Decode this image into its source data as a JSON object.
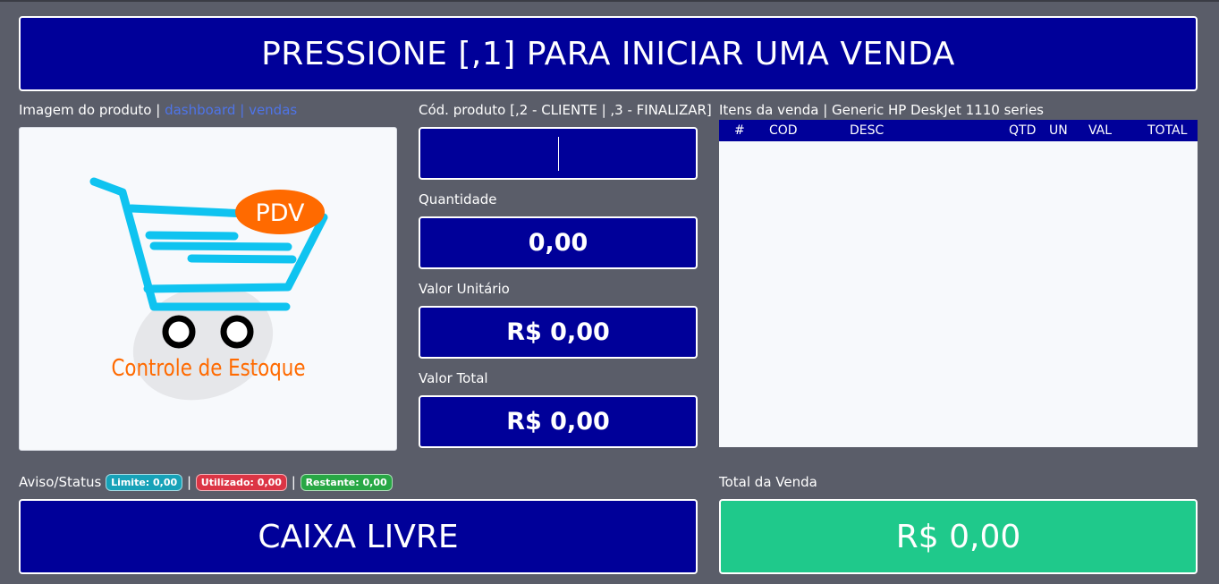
{
  "banner": "PRESSIONE [,1] PARA INICIAR UMA VENDA",
  "image_section": {
    "label": "Imagem do produto",
    "sep1": "|",
    "link_dashboard": "dashboard",
    "sep2": "|",
    "link_vendas": "vendas",
    "logo": {
      "pdv": "PDV",
      "caption": "Controle de Estoque",
      "icon": "shopping-cart-icon"
    }
  },
  "form": {
    "code_label": "Cód. produto [,2 - CLIENTE | ,3 - FINALIZAR]",
    "code_value": "",
    "quantity_label": "Quantidade",
    "quantity_value": "0,00",
    "unit_label": "Valor Unitário",
    "unit_value": "R$ 0,00",
    "total_label": "Valor Total",
    "total_value": "R$ 0,00"
  },
  "items": {
    "label": "Itens da venda | Generic HP DeskJet 1110 series",
    "columns": [
      "#",
      "COD",
      "DESC",
      "QTD",
      "UN",
      "VAL",
      "TOTAL"
    ],
    "rows": []
  },
  "status": {
    "label": "Aviso/Status",
    "limite": "Limite: 0,00",
    "utilizado": "Utilizado: 0,00",
    "restante": "Restante: 0,00",
    "sep": "|",
    "message": "CAIXA LIVRE"
  },
  "sale_total": {
    "label": "Total da Venda",
    "value": "R$ 0,00"
  },
  "colors": {
    "navy": "#000099",
    "background": "#5a5d69",
    "green": "#1fc98b",
    "limite_badge": "#17a2b8",
    "utilizado_badge": "#dc3545",
    "restante_badge": "#28a745",
    "cart_blue": "#0fc3f0",
    "pdv_orange": "#ff6a00"
  }
}
